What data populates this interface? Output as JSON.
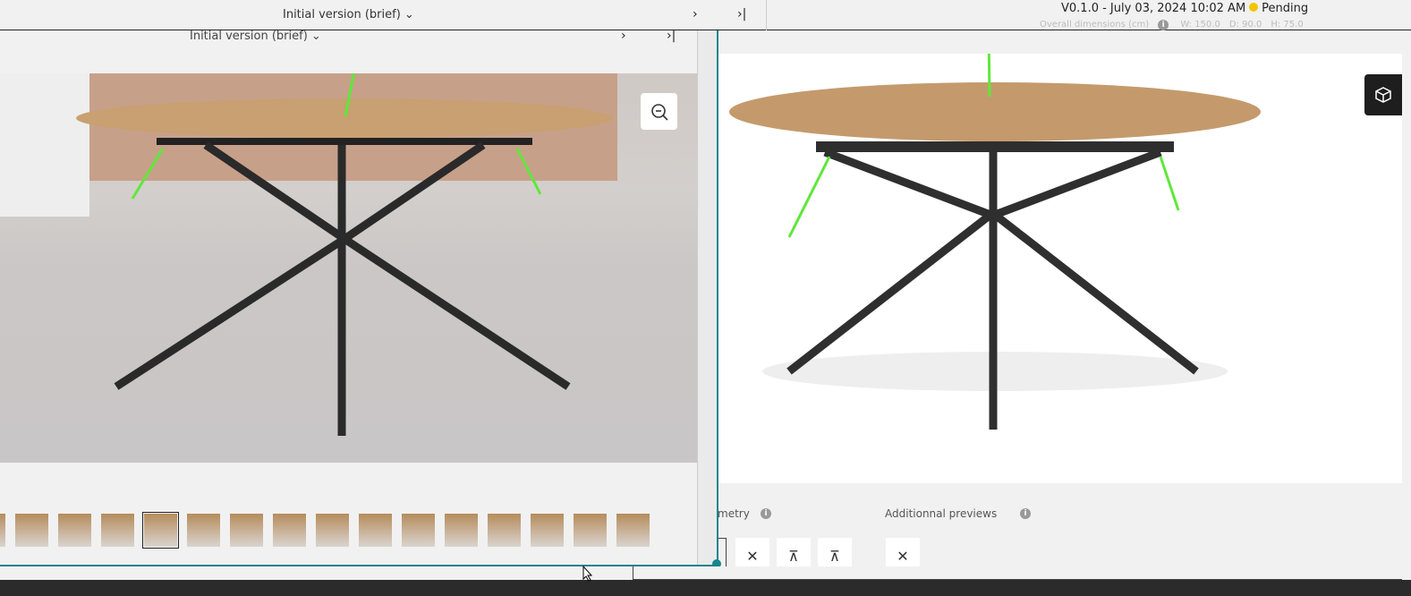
{
  "topbar": {
    "version_title": "Initial version (brief)",
    "next": "›",
    "last": "›|",
    "version_info": "V0.1.0 - July 03, 2024 10:02 AM",
    "status": "Pending",
    "status_color": "#f2c500",
    "dims_label": "Overall dimensions (cm)",
    "w": "W: 150.0",
    "d": "D: 90.0",
    "h": "H: 75.0"
  },
  "overlay": {
    "version_title": "Initial version (brief)",
    "next": "›",
    "last": "›|",
    "thumbnail_count": 16,
    "selected_thumbnail": 4
  },
  "right": {
    "geometry_label": "metry",
    "previews_label": "Additionnal previews"
  },
  "colors": {
    "accent": "#17848e",
    "arrow": "#5fe83a"
  }
}
